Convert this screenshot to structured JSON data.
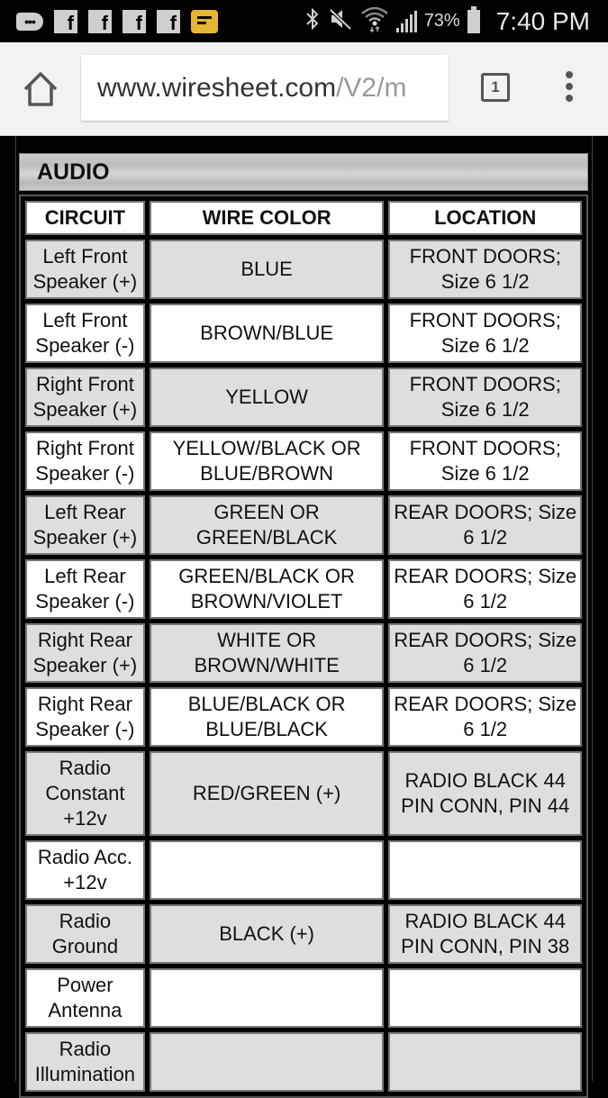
{
  "status_bar": {
    "notification_icons": [
      "more-notifications-icon",
      "facebook-icon",
      "facebook-icon",
      "facebook-icon",
      "facebook-icon",
      "message-icon"
    ],
    "system_icons": [
      "bluetooth-icon",
      "mute-icon",
      "wifi-icon",
      "signal-icon"
    ],
    "battery_percent": "73%",
    "time": "7:40 PM"
  },
  "browser": {
    "url_domain": "www.wiresheet.com",
    "url_path": "/V2/m",
    "tab_count": "1"
  },
  "section": {
    "title": "AUDIO"
  },
  "table": {
    "headers": [
      "CIRCUIT",
      "WIRE COLOR",
      "LOCATION"
    ],
    "rows": [
      {
        "circuit": "Left Front Speaker (+)",
        "wire_color": "BLUE",
        "location": "FRONT DOORS; Size 6 1/2"
      },
      {
        "circuit": "Left Front Speaker (-)",
        "wire_color": "BROWN/BLUE",
        "location": "FRONT DOORS; Size 6 1/2"
      },
      {
        "circuit": "Right Front Speaker (+)",
        "wire_color": "YELLOW",
        "location": "FRONT DOORS; Size 6 1/2"
      },
      {
        "circuit": "Right Front Speaker (-)",
        "wire_color": "YELLOW/BLACK OR BLUE/BROWN",
        "location": "FRONT DOORS; Size 6 1/2"
      },
      {
        "circuit": "Left Rear Speaker (+)",
        "wire_color": "GREEN OR GREEN/BLACK",
        "location": "REAR DOORS; Size 6 1/2"
      },
      {
        "circuit": "Left Rear Speaker (-)",
        "wire_color": "GREEN/BLACK OR BROWN/VIOLET",
        "location": "REAR DOORS; Size 6 1/2"
      },
      {
        "circuit": "Right Rear Speaker (+)",
        "wire_color": "WHITE OR BROWN/WHITE",
        "location": "REAR DOORS; Size 6 1/2"
      },
      {
        "circuit": "Right Rear Speaker (-)",
        "wire_color": "BLUE/BLACK OR BLUE/BLACK",
        "location": "REAR DOORS; Size 6 1/2"
      },
      {
        "circuit": "Radio Constant +12v",
        "wire_color": "RED/GREEN (+)",
        "location": "RADIO BLACK 44 PIN CONN, PIN 44"
      },
      {
        "circuit": "Radio Acc. +12v",
        "wire_color": "",
        "location": ""
      },
      {
        "circuit": "Radio Ground",
        "wire_color": "BLACK (+)",
        "location": "RADIO BLACK 44 PIN CONN, PIN 38"
      },
      {
        "circuit": "Power Antenna",
        "wire_color": "",
        "location": ""
      },
      {
        "circuit": "Radio Illumination",
        "wire_color": "",
        "location": ""
      }
    ]
  }
}
